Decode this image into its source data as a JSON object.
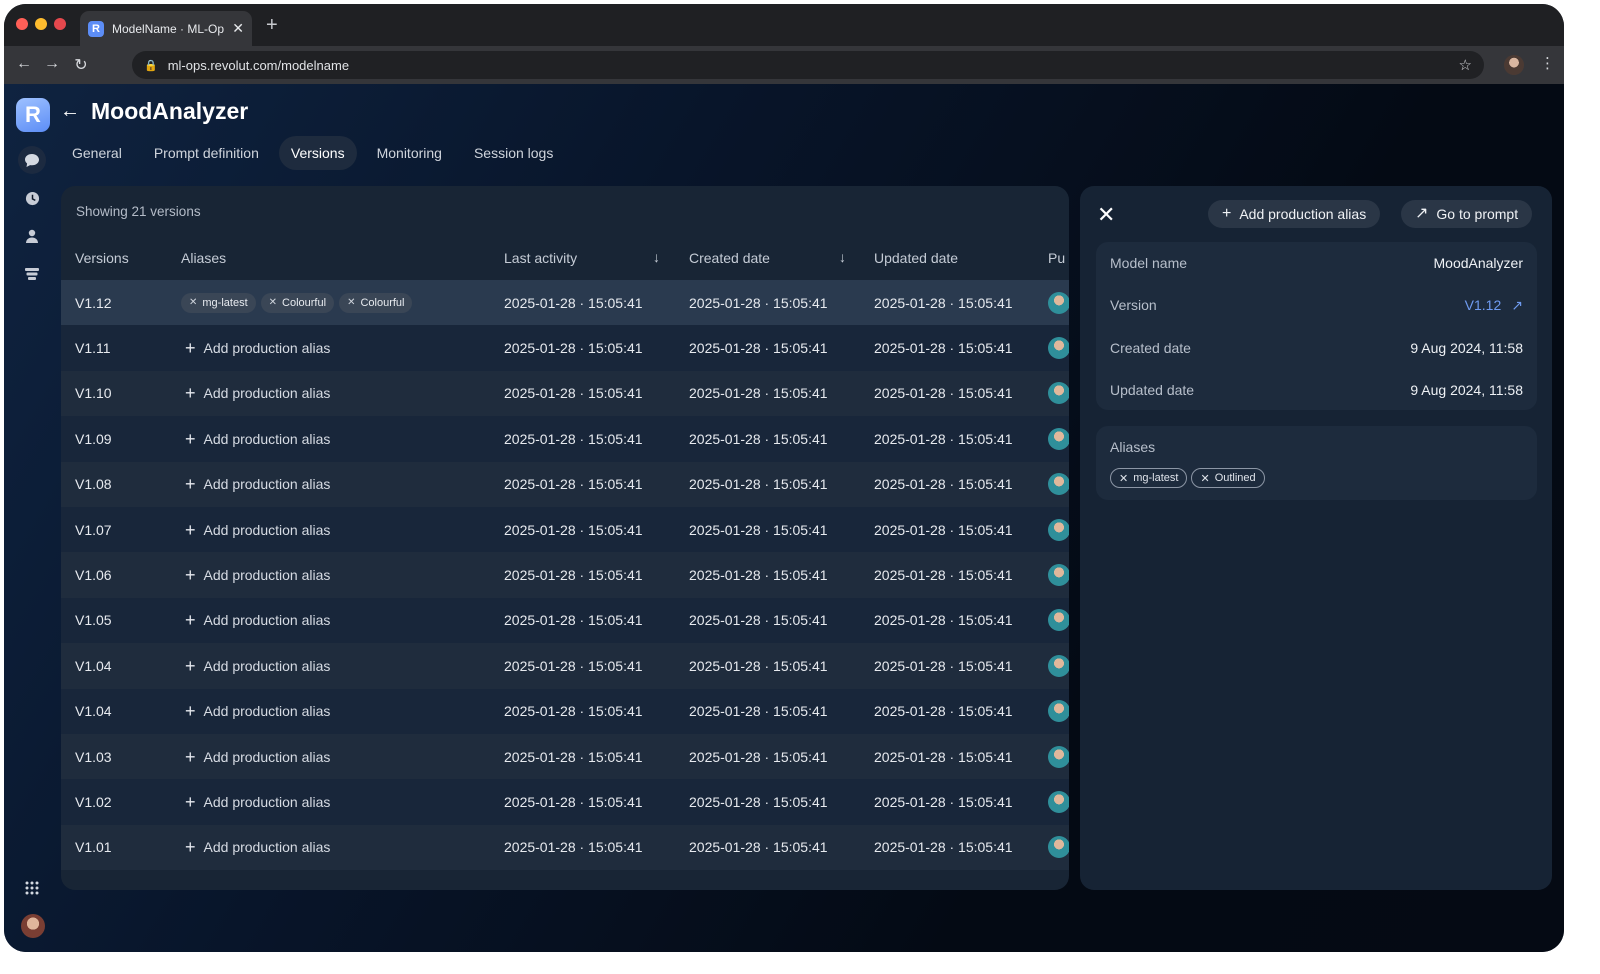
{
  "browser": {
    "tab_title": "ModelName · ML-Ops",
    "favicon_letter": "R",
    "url": "ml-ops.revolut.com/modelname"
  },
  "app": {
    "logo_letter": "R",
    "page_title": "MoodAnalyzer",
    "tabs": [
      {
        "label": "General"
      },
      {
        "label": "Prompt definition"
      },
      {
        "label": "Versions"
      },
      {
        "label": "Monitoring"
      },
      {
        "label": "Session logs"
      }
    ],
    "active_tab": "Versions"
  },
  "table": {
    "showing": "Showing 21 versions",
    "columns": {
      "versions": "Versions",
      "aliases": "Aliases",
      "last_activity": "Last activity",
      "created_date": "Created date",
      "updated_date": "Updated date",
      "published": "Pu"
    },
    "add_alias_label": "Add production alias",
    "rows": [
      {
        "version": "V1.12",
        "aliases": [
          "mg-latest",
          "Colourful",
          "Colourful"
        ],
        "last_activity": "2025-01-28 · 15:05:41",
        "created": "2025-01-28 · 15:05:41",
        "updated": "2025-01-28 · 15:05:41"
      },
      {
        "version": "V1.11",
        "aliases": [],
        "last_activity": "2025-01-28 · 15:05:41",
        "created": "2025-01-28 · 15:05:41",
        "updated": "2025-01-28 · 15:05:41"
      },
      {
        "version": "V1.10",
        "aliases": [],
        "last_activity": "2025-01-28 · 15:05:41",
        "created": "2025-01-28 · 15:05:41",
        "updated": "2025-01-28 · 15:05:41"
      },
      {
        "version": "V1.09",
        "aliases": [],
        "last_activity": "2025-01-28 · 15:05:41",
        "created": "2025-01-28 · 15:05:41",
        "updated": "2025-01-28 · 15:05:41"
      },
      {
        "version": "V1.08",
        "aliases": [],
        "last_activity": "2025-01-28 · 15:05:41",
        "created": "2025-01-28 · 15:05:41",
        "updated": "2025-01-28 · 15:05:41"
      },
      {
        "version": "V1.07",
        "aliases": [],
        "last_activity": "2025-01-28 · 15:05:41",
        "created": "2025-01-28 · 15:05:41",
        "updated": "2025-01-28 · 15:05:41"
      },
      {
        "version": "V1.06",
        "aliases": [],
        "last_activity": "2025-01-28 · 15:05:41",
        "created": "2025-01-28 · 15:05:41",
        "updated": "2025-01-28 · 15:05:41"
      },
      {
        "version": "V1.05",
        "aliases": [],
        "last_activity": "2025-01-28 · 15:05:41",
        "created": "2025-01-28 · 15:05:41",
        "updated": "2025-01-28 · 15:05:41"
      },
      {
        "version": "V1.04",
        "aliases": [],
        "last_activity": "2025-01-28 · 15:05:41",
        "created": "2025-01-28 · 15:05:41",
        "updated": "2025-01-28 · 15:05:41"
      },
      {
        "version": "V1.04",
        "aliases": [],
        "last_activity": "2025-01-28 · 15:05:41",
        "created": "2025-01-28 · 15:05:41",
        "updated": "2025-01-28 · 15:05:41"
      },
      {
        "version": "V1.03",
        "aliases": [],
        "last_activity": "2025-01-28 · 15:05:41",
        "created": "2025-01-28 · 15:05:41",
        "updated": "2025-01-28 · 15:05:41"
      },
      {
        "version": "V1.02",
        "aliases": [],
        "last_activity": "2025-01-28 · 15:05:41",
        "created": "2025-01-28 · 15:05:41",
        "updated": "2025-01-28 · 15:05:41"
      },
      {
        "version": "V1.01",
        "aliases": [],
        "last_activity": "2025-01-28 · 15:05:41",
        "created": "2025-01-28 · 15:05:41",
        "updated": "2025-01-28 · 15:05:41"
      }
    ]
  },
  "detail": {
    "add_alias_button": "Add production alias",
    "go_to_prompt_button": "Go to prompt",
    "model_name_label": "Model name",
    "model_name_value": "MoodAnalyzer",
    "version_label": "Version",
    "version_value": "V1.12",
    "created_label": "Created date",
    "created_value": "9 Aug 2024, 11:58",
    "updated_label": "Updated date",
    "updated_value": "9 Aug 2024, 11:58",
    "aliases_title": "Aliases",
    "aliases": [
      "mg-latest",
      "Outlined"
    ]
  },
  "colors": {
    "accent": "#6f9bf0",
    "background": "#050b16",
    "panel": "#182535"
  }
}
